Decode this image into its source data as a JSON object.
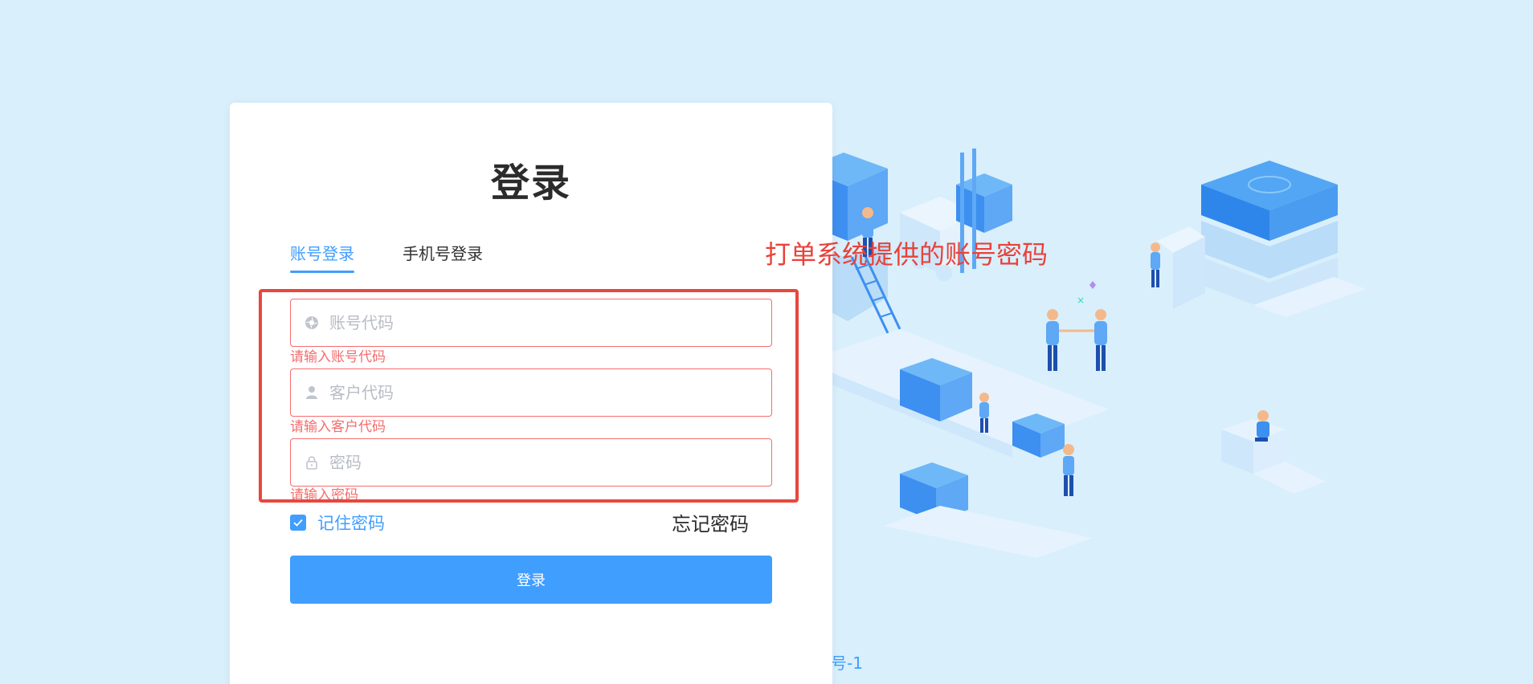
{
  "login": {
    "title": "登录",
    "tabs": [
      {
        "label": "账号登录",
        "active": true
      },
      {
        "label": "手机号登录",
        "active": false
      }
    ],
    "annotation": "打单系统提供的账号密码",
    "fields": [
      {
        "icon": "gear-icon",
        "placeholder": "账号代码",
        "value": "",
        "error": "请输入账号代码"
      },
      {
        "icon": "user-icon",
        "placeholder": "客户代码",
        "value": "",
        "error": "请输入客户代码"
      },
      {
        "icon": "lock-icon",
        "placeholder": "密码",
        "value": "",
        "error": "请输入密码"
      }
    ],
    "remember_label": "记住密码",
    "remember_checked": true,
    "forgot_label": "忘记密码",
    "submit_label": "登录"
  },
  "footer": {
    "text": "号-1"
  },
  "colors": {
    "background": "#d9effc",
    "primary": "#409eff",
    "error": "#f56c6c",
    "annotation": "#e8473e"
  }
}
